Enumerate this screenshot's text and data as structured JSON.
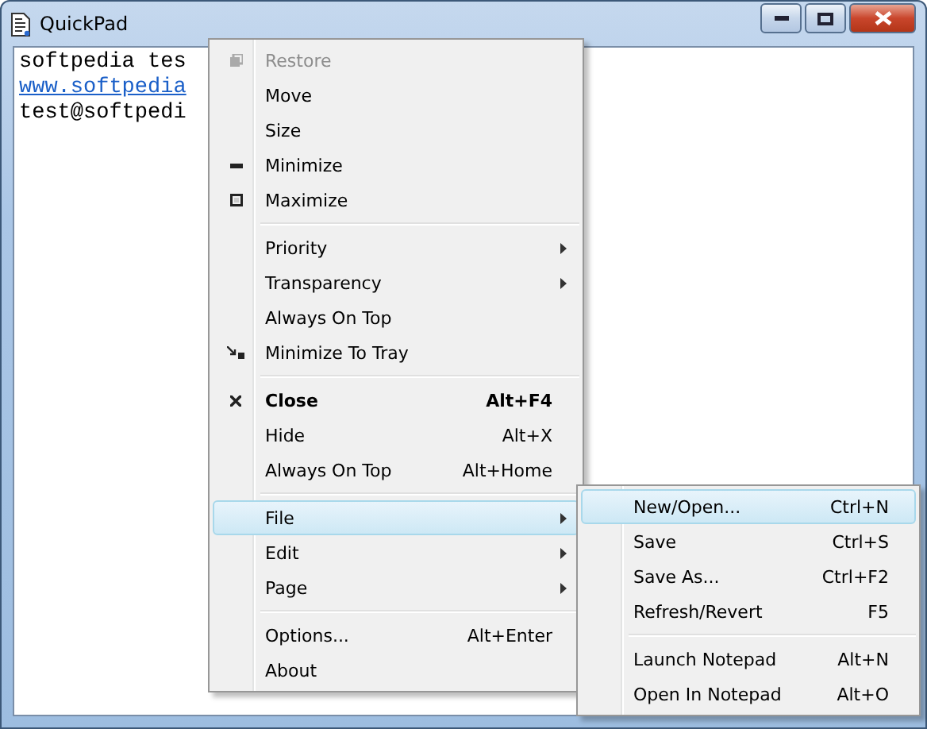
{
  "window": {
    "title": "QuickPad"
  },
  "editor": {
    "lines": [
      {
        "kind": "text",
        "text": "softpedia tes"
      },
      {
        "kind": "link",
        "text": "www.softpedia"
      },
      {
        "kind": "text",
        "text": "test@softpedi"
      }
    ]
  },
  "context_menu": {
    "items": [
      {
        "kind": "item",
        "label": "Restore",
        "disabled": true
      },
      {
        "kind": "item",
        "label": "Move",
        "disabled": false
      },
      {
        "kind": "item",
        "label": "Size",
        "disabled": false
      },
      {
        "kind": "item",
        "label": "Minimize",
        "disabled": false
      },
      {
        "kind": "item",
        "label": "Maximize",
        "disabled": false
      },
      {
        "kind": "separator"
      },
      {
        "kind": "item",
        "label": "Priority",
        "disabled": false,
        "submenu": true
      },
      {
        "kind": "item",
        "label": "Transparency",
        "disabled": false,
        "submenu": true
      },
      {
        "kind": "item",
        "label": "Always On Top",
        "disabled": false
      },
      {
        "kind": "item",
        "label": "Minimize To Tray",
        "disabled": false
      },
      {
        "kind": "separator"
      },
      {
        "kind": "item",
        "label": "Close",
        "disabled": false,
        "bold": true,
        "shortcut": "Alt+F4"
      },
      {
        "kind": "item",
        "label": "Hide",
        "disabled": false,
        "shortcut": "Alt+X"
      },
      {
        "kind": "item",
        "label": "Always On Top",
        "disabled": false,
        "shortcut": "Alt+Home"
      },
      {
        "kind": "separator"
      },
      {
        "kind": "item",
        "label": "File",
        "disabled": false,
        "submenu": true,
        "selected": true
      },
      {
        "kind": "item",
        "label": "Edit",
        "disabled": false,
        "submenu": true,
        "selected": false
      },
      {
        "kind": "item",
        "label": "Page",
        "disabled": false,
        "submenu": true,
        "selected": false
      },
      {
        "kind": "separator"
      },
      {
        "kind": "item",
        "label": "Options...",
        "disabled": false,
        "shortcut": "Alt+Enter"
      },
      {
        "kind": "item",
        "label": "About",
        "disabled": false
      }
    ]
  },
  "file_submenu": {
    "items": [
      {
        "kind": "item",
        "label": "New/Open...",
        "shortcut": "Ctrl+N",
        "selected": true
      },
      {
        "kind": "item",
        "label": "Save",
        "shortcut": "Ctrl+S",
        "selected": false
      },
      {
        "kind": "item",
        "label": "Save As...",
        "shortcut": "Ctrl+F2",
        "selected": false
      },
      {
        "kind": "item",
        "label": "Refresh/Revert",
        "shortcut": "F5",
        "selected": false
      },
      {
        "kind": "separator"
      },
      {
        "kind": "item",
        "label": "Launch Notepad",
        "shortcut": "Alt+N",
        "selected": false
      },
      {
        "kind": "item",
        "label": "Open In Notepad",
        "shortcut": "Alt+O",
        "selected": false
      }
    ]
  }
}
